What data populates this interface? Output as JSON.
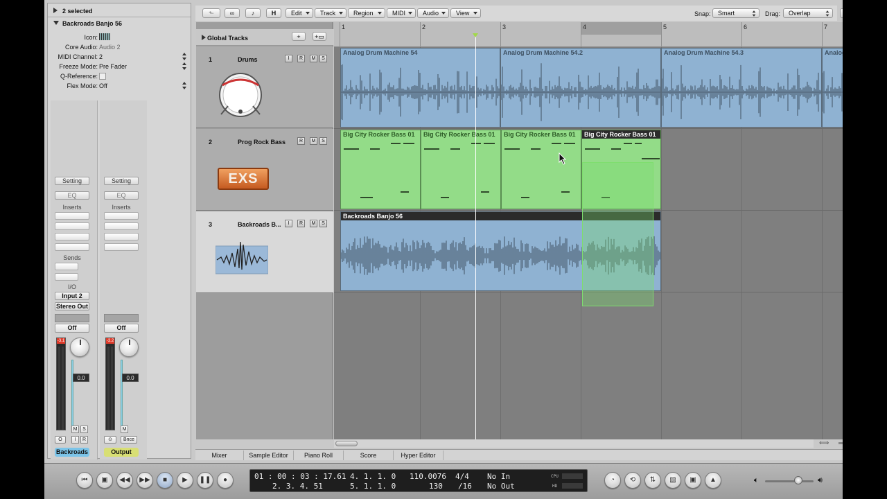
{
  "inspector": {
    "selection": "2 selected",
    "region_name": "Backroads Banjo 56",
    "params": [
      {
        "label": "Icon:",
        "value": ""
      },
      {
        "label": "Core Audio:",
        "value": "Audio 2"
      },
      {
        "label": "MIDI Channel:",
        "value": "2"
      },
      {
        "label": "Freeze Mode:",
        "value": "Pre Fader"
      },
      {
        "label": "Q-Reference:",
        "value": ""
      },
      {
        "label": "Flex Mode:",
        "value": "Off"
      }
    ],
    "strips": [
      {
        "setting": "Setting",
        "eq": "EQ",
        "inserts": "Inserts",
        "sends": "Sends",
        "io": "I/O",
        "input": "Input 2",
        "output": "Stereo Out",
        "auto": "Off",
        "fader": "0.0",
        "peak": "-3.1",
        "name": "Backroads",
        "name_color": "#7cc4e8",
        "btn_m": "M",
        "btn_s": "S",
        "btn_o": "O",
        "btn_i": "I",
        "btn_r": "R"
      },
      {
        "setting": "Setting",
        "eq": "EQ",
        "inserts": "Inserts",
        "auto": "Off",
        "fader": "0.0",
        "peak": "-3.2",
        "name": "Output",
        "name_color": "#d8df74",
        "btn_m": "M",
        "btn_link": "⊙",
        "btn_bnce": "Bnce"
      }
    ]
  },
  "toolbar": {
    "menus": [
      "Edit",
      "Track",
      "Region",
      "MIDI",
      "Audio",
      "View"
    ],
    "h_label": "H",
    "snap_label": "Snap:",
    "snap_value": "Smart",
    "drag_label": "Drag:",
    "drag_value": "Overlap"
  },
  "global_tracks": "Global Tracks",
  "tracks": [
    {
      "num": "1",
      "name": "Drums",
      "buttons": [
        "I",
        "R",
        "M",
        "S"
      ]
    },
    {
      "num": "2",
      "name": "Prog Rock Bass",
      "buttons": [
        "R",
        "M",
        "S"
      ],
      "exs": "EXS"
    },
    {
      "num": "3",
      "name": "Backroads B...",
      "buttons": [
        "I",
        "R",
        "M",
        "S"
      ]
    }
  ],
  "ruler": [
    "1",
    "2",
    "3",
    "4",
    "5",
    "6",
    "7"
  ],
  "regions": {
    "drums": [
      "Analog Drum Machine 54",
      "Analog Drum Machine 54.2",
      "Analog Drum Machine 54.3",
      "Analog Drum Mac"
    ],
    "bass": [
      "Big City Rocker Bass 01",
      "Big City Rocker Bass 01",
      "Big City Rocker Bass 01",
      "Big City Rocker Bass 01"
    ],
    "banjo": "Backroads Banjo 56"
  },
  "bottom_tabs": [
    "Mixer",
    "Sample Editor",
    "Piano Roll",
    "Score",
    "Hyper Editor"
  ],
  "transport": {
    "time": "01 : 00 : 03 : 17.61",
    "time2": "2.   3.   4.   51",
    "bars": "4.   1.   1.     0",
    "bars2": "5.   1.   1.     0",
    "tempo": "110.0076",
    "tempo2": "130",
    "sig": "4/4",
    "div": "/16",
    "in": "No In",
    "out": "No Out",
    "cpu": "CPU",
    "hd": "HD"
  },
  "colors": {
    "audio_region": "#8fb2d2",
    "midi_region": "#93dc88",
    "playhead": "#ffffff",
    "selection": "#7ede6e"
  }
}
